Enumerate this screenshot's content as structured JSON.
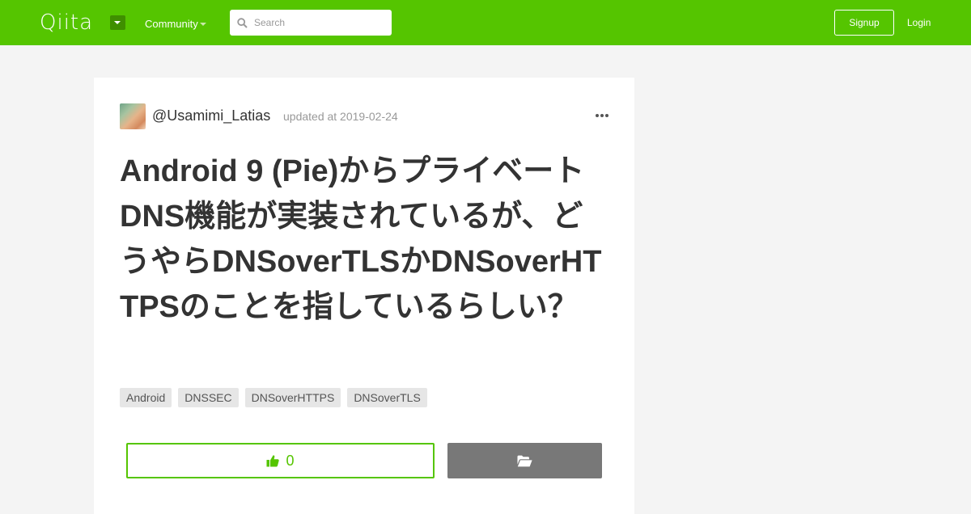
{
  "header": {
    "logo": "Qiita",
    "community_label": "Community",
    "search_placeholder": "Search",
    "signup_label": "Signup",
    "login_label": "Login",
    "brand_color": "#55c500"
  },
  "article": {
    "author": "@Usamimi_Latias",
    "updated": "updated at 2019-02-24",
    "title": "Android 9 (Pie)からプライベートDNS機能が実装されているが、どうやらDNSoverTLSかDNSoverHTTPSのことを指しているらしい？",
    "tags": [
      "Android",
      "DNSSEC",
      "DNSoverHTTPS",
      "DNSoverTLS"
    ],
    "like_count": "0"
  },
  "icons": {
    "header_menu": "caret-down-icon",
    "search": "search-icon",
    "more": "more-horizontal-icon",
    "like": "thumbs-up-icon",
    "stock": "folder-open-icon"
  }
}
